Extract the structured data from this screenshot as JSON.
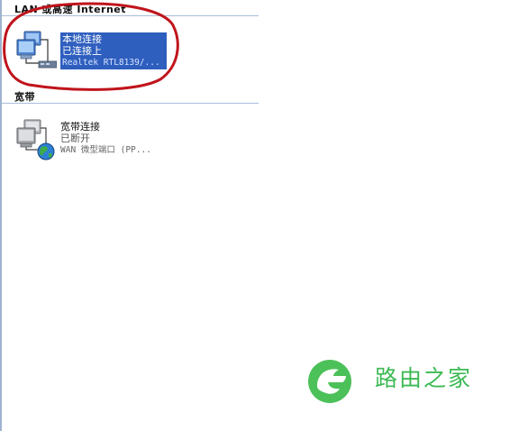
{
  "sections": {
    "lan": {
      "header": "LAN 或高速 Internet",
      "connections": [
        {
          "name": "本地连接",
          "status": "已连接上",
          "device": "Realtek RTL8139/...",
          "selected": true
        }
      ]
    },
    "broadband": {
      "header": "宽带",
      "connections": [
        {
          "name": "宽带连接",
          "status": "已断开",
          "device": "WAN 微型端口 (PP...",
          "selected": false
        }
      ]
    }
  },
  "icons": {
    "lan_connection": "network-computers-icon",
    "broadband_connection": "broadband-globe-icon",
    "watermark_logo": "luyou-logo-icon"
  },
  "annotation": {
    "color": "#c0141c"
  },
  "watermark": {
    "text": "路由之家",
    "color": "#3cba54"
  },
  "colors": {
    "selection": "#2f5fbe",
    "rule": "#a8bdd8"
  }
}
